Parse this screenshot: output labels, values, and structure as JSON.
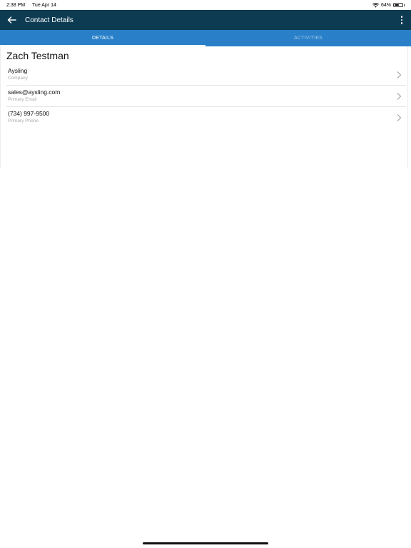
{
  "status_bar": {
    "time": "2:38 PM",
    "date": "Tue Apr 14",
    "battery_text": "64%",
    "battery_level": 0.64,
    "wifi_icon": "wifi-icon"
  },
  "app_bar": {
    "title": "Contact Details",
    "back_icon": "arrow-left-icon",
    "more_icon": "more-vertical-icon",
    "background": "#0d3b52"
  },
  "tabs": [
    {
      "label": "DETAILS",
      "active": true
    },
    {
      "label": "ACTIVITIES",
      "active": false
    }
  ],
  "tab_color": "#2980c9",
  "contact": {
    "name": "Zach Testman",
    "details": [
      {
        "value": "Aysling",
        "label": "Company"
      },
      {
        "value": "sales@aysling.com",
        "label": "Primary Email"
      },
      {
        "value": "(734) 997-9500",
        "label": "Primary Phone"
      }
    ]
  }
}
